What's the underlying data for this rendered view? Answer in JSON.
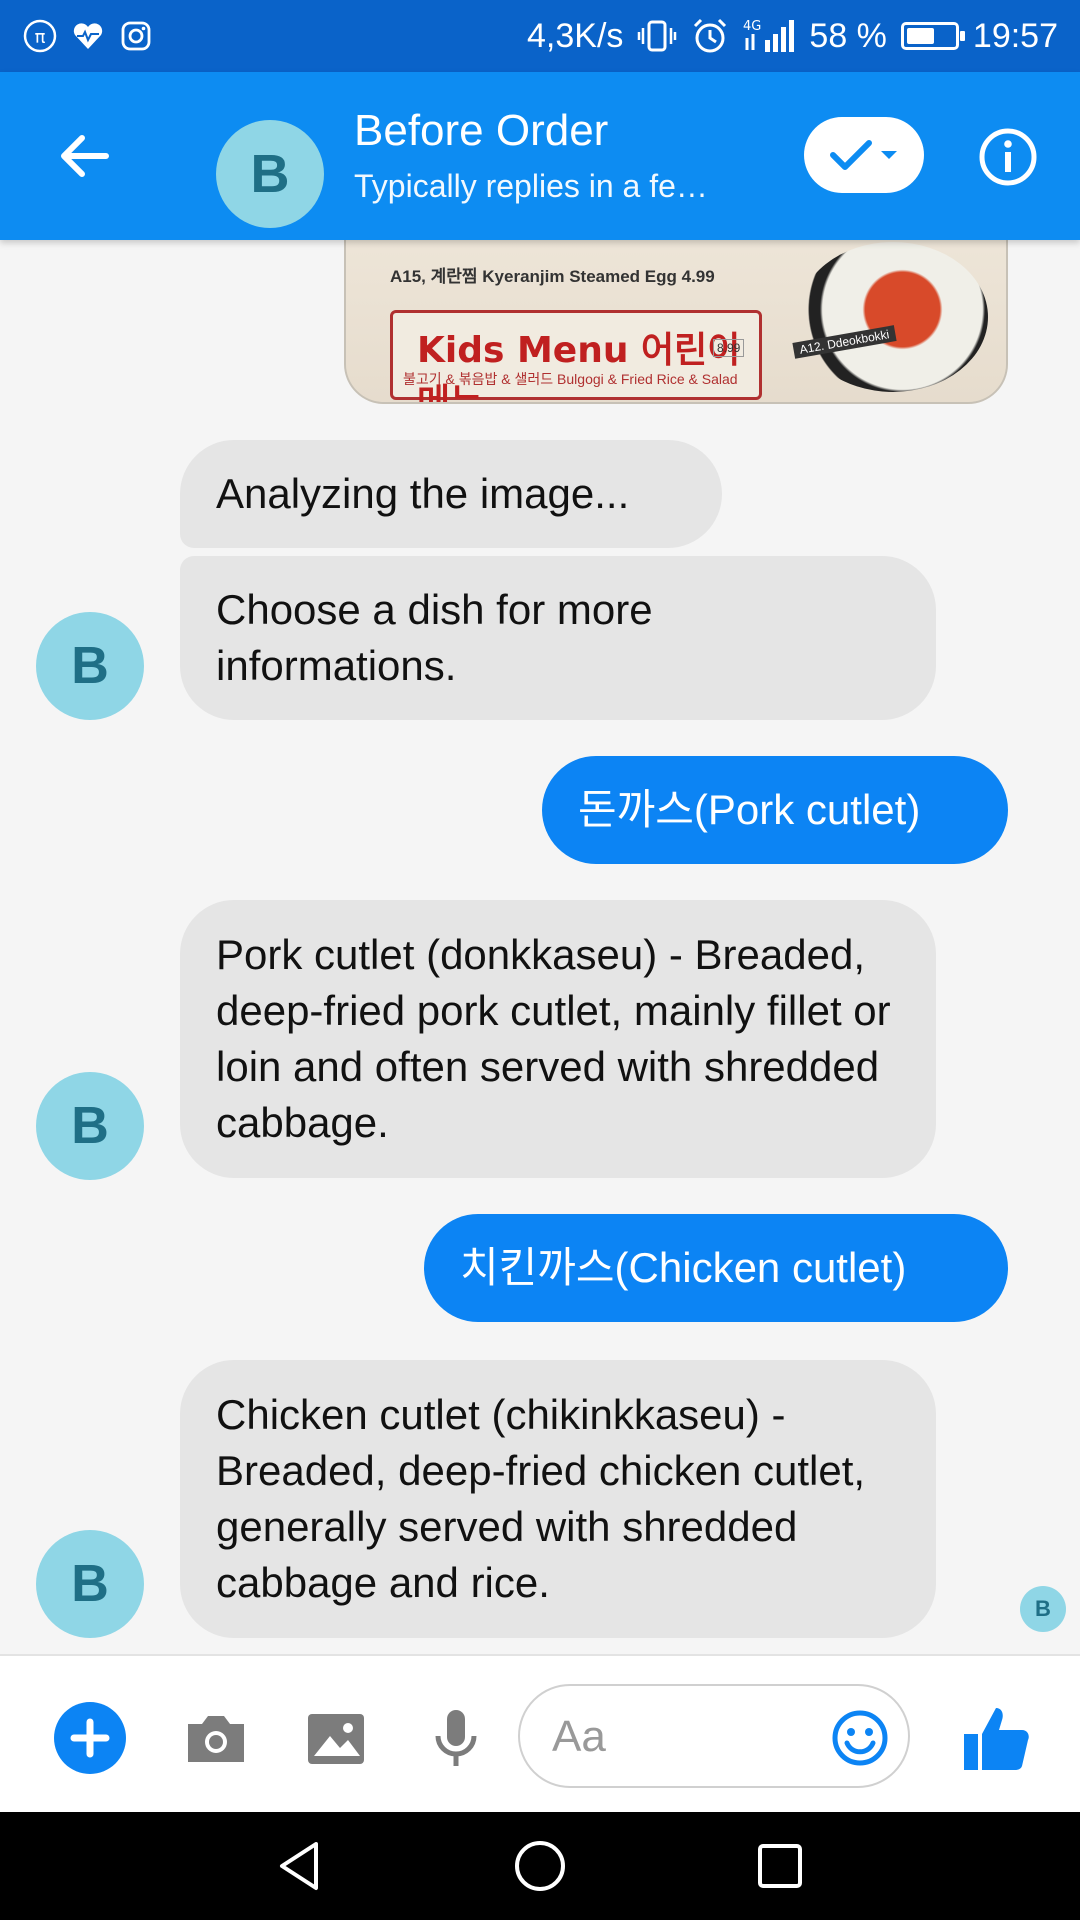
{
  "status_bar": {
    "speed": "4,3K/s",
    "battery_pct": "58 %",
    "battery_level": 0.58,
    "time": "19:57",
    "icons": [
      "pi-icon",
      "health-heart-icon",
      "instagram-icon",
      "vibrate-icon",
      "alarm-icon",
      "4g-signal-icon",
      "battery-icon"
    ]
  },
  "header": {
    "avatar_letter": "B",
    "title": "Before Order",
    "subtitle": "Typically replies in a fe…",
    "colors": {
      "bar": "#0d8cf2",
      "status": "#0a63c9"
    }
  },
  "menu_image": {
    "line1": "A15, 계란찜 Kyeranjim Steamed Egg 4.99",
    "kids_title": "Kids Menu 어린이메뉴",
    "kids_price": "8.99",
    "kids_sub": "불고기 & 볶음밥 & 샐러드 Bulgogi & Fried Rice & Salad",
    "dish_label": "A12. Ddeokbokki"
  },
  "messages": [
    {
      "from": "bot",
      "text": "Analyzing the image..."
    },
    {
      "from": "bot",
      "text": "Choose a dish for more informations."
    },
    {
      "from": "user",
      "text": "돈까스(Pork cutlet)"
    },
    {
      "from": "bot",
      "text": "Pork cutlet (donkkaseu) - Breaded, deep-fried pork cutlet, mainly fillet or loin and often served with shredded cabbage."
    },
    {
      "from": "user",
      "text": "치킨까스(Chicken cutlet)"
    },
    {
      "from": "bot",
      "text": "Chicken cutlet (chikinkkaseu) - Breaded, deep-fried chicken cutlet, generally served with shredded cabbage and rice."
    }
  ],
  "bot_avatar_letter": "B",
  "seen_avatar_letter": "B",
  "composer": {
    "placeholder": "Aa",
    "accent": "#0c84f4"
  }
}
